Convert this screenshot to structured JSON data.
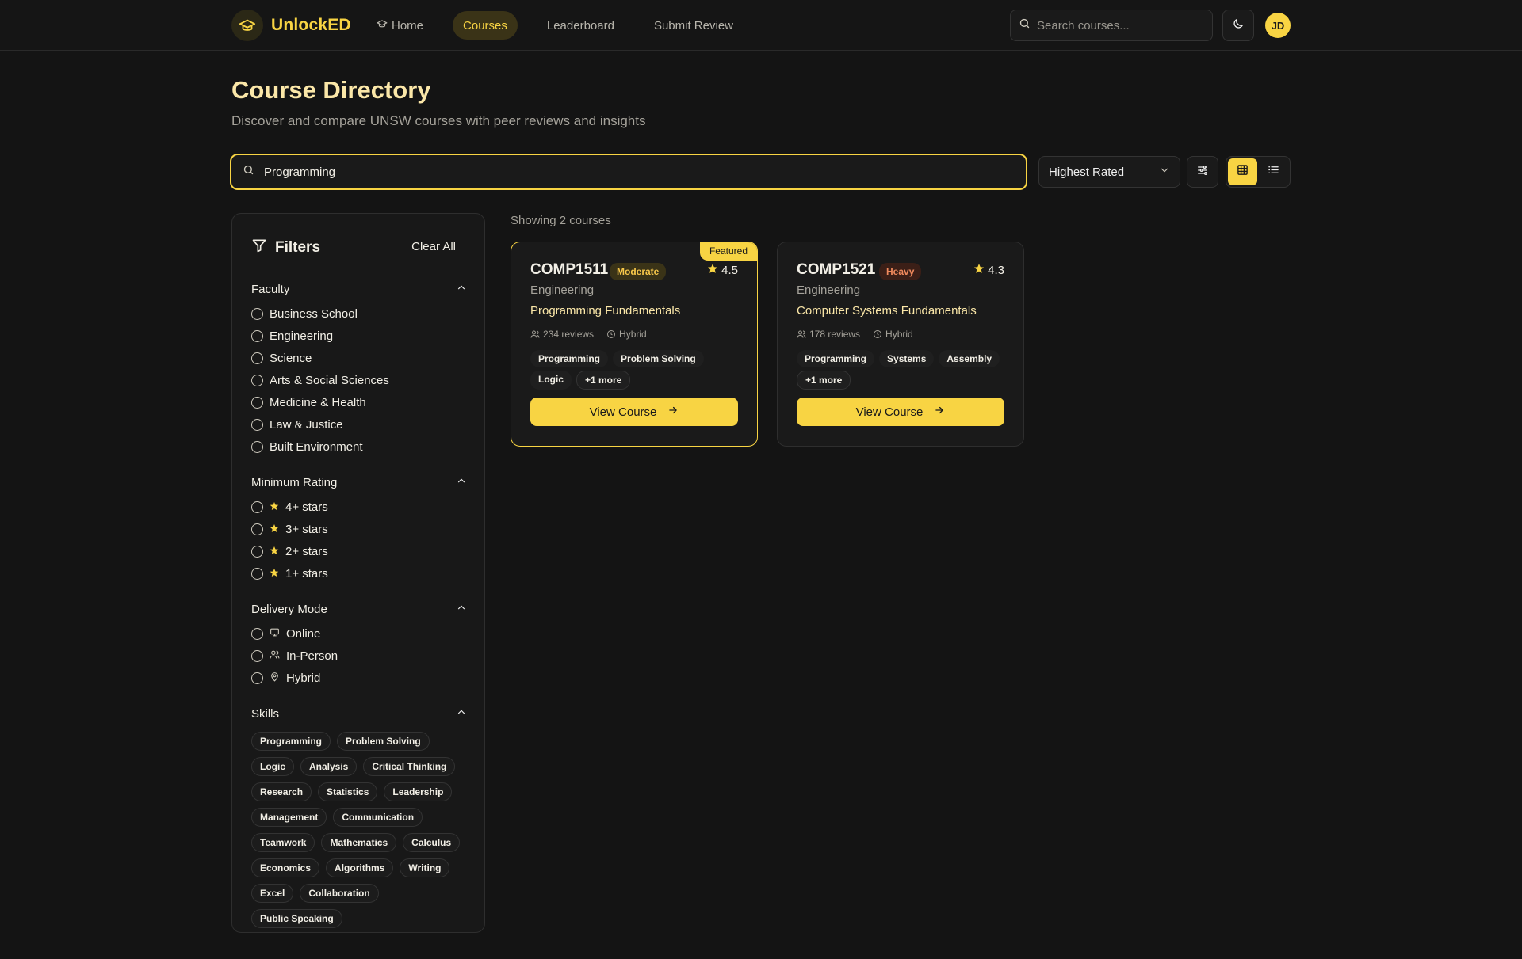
{
  "brand": {
    "name": "UnlockED",
    "accent": "#f8d443",
    "background": "#141414"
  },
  "nav": {
    "items": [
      {
        "label": "Home",
        "active": false,
        "icon": "graduation-cap-icon"
      },
      {
        "label": "Courses",
        "active": true
      },
      {
        "label": "Leaderboard",
        "active": false
      },
      {
        "label": "Submit Review",
        "active": false
      }
    ]
  },
  "header": {
    "search_placeholder": "Search courses...",
    "theme_icon": "moon-icon",
    "avatar_initials": "JD"
  },
  "page": {
    "title": "Course Directory",
    "subtitle": "Discover and compare UNSW courses with peer reviews and insights"
  },
  "search": {
    "value": "Programming"
  },
  "sort": {
    "selected": "Highest Rated"
  },
  "view": {
    "mode": "grid"
  },
  "filters": {
    "title": "Filters",
    "clear_label": "Clear All",
    "faculty": {
      "title": "Faculty",
      "options": [
        "Business School",
        "Engineering",
        "Science",
        "Arts & Social Sciences",
        "Medicine & Health",
        "Law & Justice",
        "Built Environment"
      ]
    },
    "rating": {
      "title": "Minimum Rating",
      "options": [
        "4+ stars",
        "3+ stars",
        "2+ stars",
        "1+ stars"
      ]
    },
    "delivery": {
      "title": "Delivery Mode",
      "options": [
        {
          "label": "Online",
          "icon": "monitor-icon"
        },
        {
          "label": "In-Person",
          "icon": "users-icon"
        },
        {
          "label": "Hybrid",
          "icon": "map-pin-icon"
        }
      ]
    },
    "skills": {
      "title": "Skills",
      "options": [
        "Programming",
        "Problem Solving",
        "Logic",
        "Analysis",
        "Critical Thinking",
        "Research",
        "Statistics",
        "Leadership",
        "Management",
        "Communication",
        "Teamwork",
        "Mathematics",
        "Calculus",
        "Economics",
        "Algorithms",
        "Writing",
        "Excel",
        "Collaboration",
        "Public Speaking"
      ]
    }
  },
  "results": {
    "showing_text": "Showing 2 courses",
    "courses": [
      {
        "code": "COMP1511",
        "workload": "Moderate",
        "rating": "4.5",
        "faculty": "Engineering",
        "name": "Programming Fundamentals",
        "reviews": "234 reviews",
        "delivery": "Hybrid",
        "skills": [
          "Programming",
          "Problem Solving",
          "Logic"
        ],
        "more": "+1 more",
        "featured_label": "Featured",
        "button_label": "View Course"
      },
      {
        "code": "COMP1521",
        "workload": "Heavy",
        "rating": "4.3",
        "faculty": "Engineering",
        "name": "Computer Systems Fundamentals",
        "reviews": "178 reviews",
        "delivery": "Hybrid",
        "skills": [
          "Programming",
          "Systems",
          "Assembly"
        ],
        "more": "+1 more",
        "button_label": "View Course"
      }
    ]
  }
}
